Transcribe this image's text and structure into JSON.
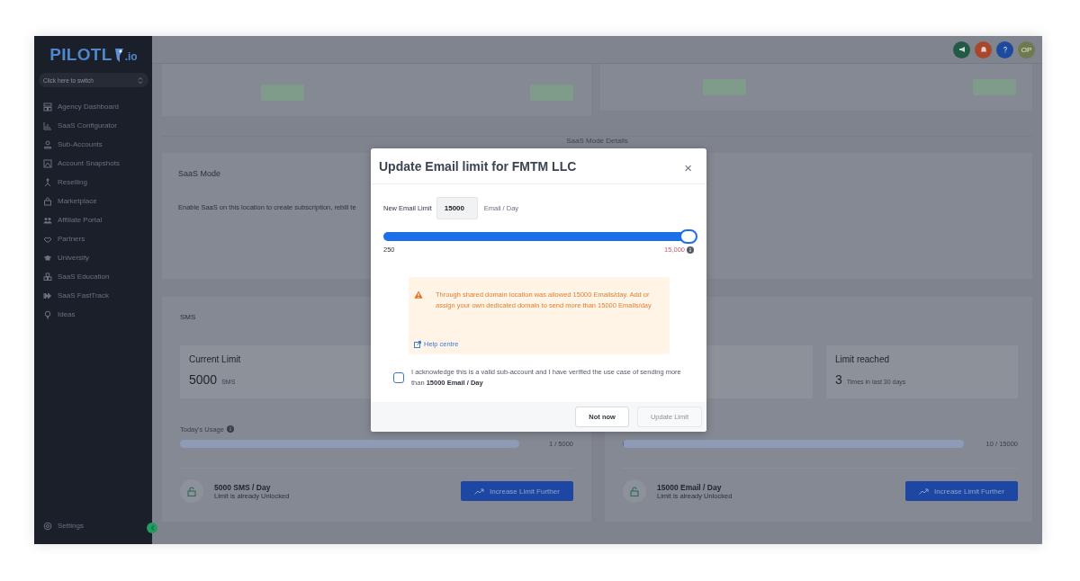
{
  "sidebar": {
    "logo": {
      "name": "PILOTL",
      "tld": ".io"
    },
    "switcher": {
      "label": "Click here to switch"
    },
    "items": [
      {
        "label": "Agency Dashboard"
      },
      {
        "label": "SaaS Configurator"
      },
      {
        "label": "Sub-Accounts"
      },
      {
        "label": "Account Snapshots"
      },
      {
        "label": "Reselling"
      },
      {
        "label": "Marketplace"
      },
      {
        "label": "Affiliate Portal"
      },
      {
        "label": "Partners"
      },
      {
        "label": "University"
      },
      {
        "label": "SaaS Education"
      },
      {
        "label": "SaaS FastTrack"
      },
      {
        "label": "Ideas"
      }
    ],
    "settings": {
      "label": "Settings"
    }
  },
  "header": {
    "avatar": {
      "initials": "OP"
    }
  },
  "saas_mode_details": {
    "label": "SaaS Mode Details"
  },
  "saas_mode": {
    "title": "SaaS Mode",
    "description": "Enable SaaS on this location to create subscription, rebill te"
  },
  "sms": {
    "title": "SMS",
    "stat": {
      "label": "Current Limit",
      "value": "5000",
      "unit": "SMS"
    },
    "usage": {
      "label": "Today's Usage",
      "level": 0.0002,
      "reading": "1 / 5000"
    },
    "plan": {
      "title": "5000 SMS / Day",
      "subtitle": "Limit is already Unlocked"
    },
    "button": "Increase Limit Further"
  },
  "email": {
    "stat": {
      "label": "Limit reached",
      "value": "3",
      "unit": "Times in last 30 days"
    },
    "usage": {
      "level": 0.0007,
      "reading": "10 / 15000"
    },
    "plan": {
      "title": "15000 Email / Day",
      "subtitle": "Limit is already Unlocked"
    },
    "button": "Increase Limit Further"
  },
  "modal": {
    "title": "Update Email limit for FMTM LLC",
    "close": "×",
    "field": {
      "label": "New Email Limit",
      "value": "15000",
      "unit": "Email / Day"
    },
    "slider": {
      "level": 1,
      "min": "250",
      "max": "15,000"
    },
    "alert": {
      "text": "Through shared domain location was allowed 15000 Emails/day. Add or assign your own dedicated domain to send more than 15000 Emails/day",
      "link": "Help centre"
    },
    "acknowledge": {
      "text": "I acknowledge this is a valid sub-account and I have verified the use case of sending more than **15000 Email / Day**",
      "checked": false
    },
    "buttons": [
      {
        "label": "Not now",
        "disabled": false
      },
      {
        "label": "Update Limit",
        "disabled": true
      }
    ]
  }
}
